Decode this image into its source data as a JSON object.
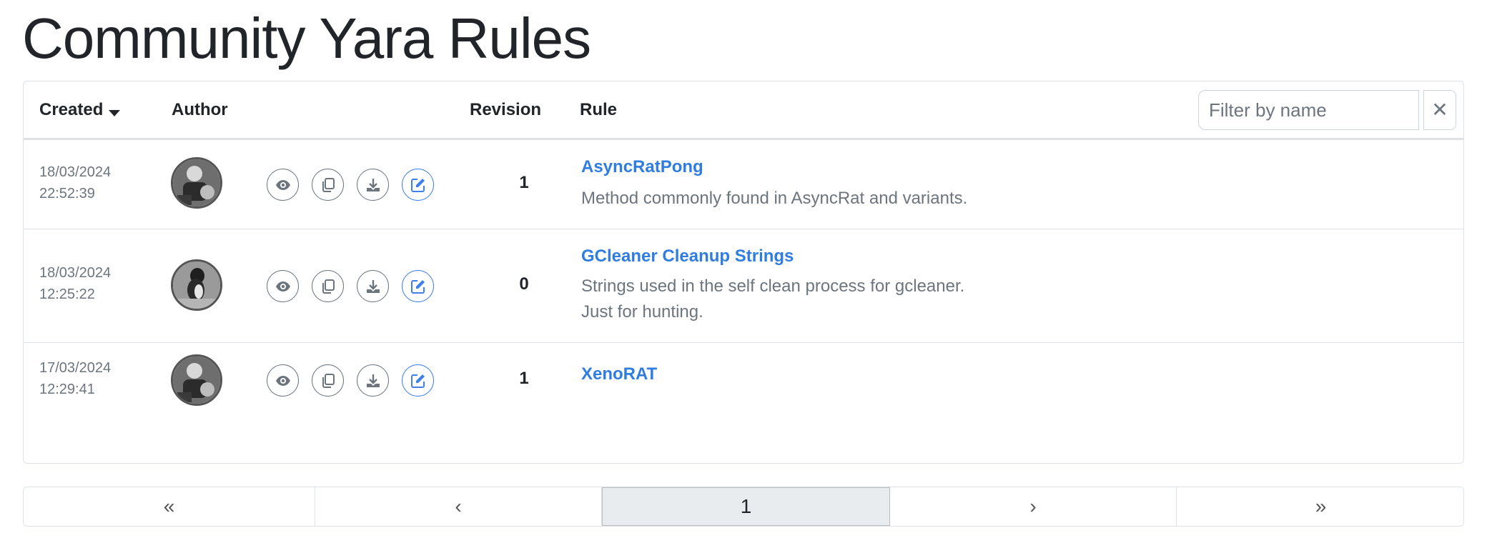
{
  "page": {
    "title": "Community Yara Rules"
  },
  "table": {
    "columns": {
      "created": "Created",
      "author": "Author",
      "revision": "Revision",
      "rule": "Rule"
    },
    "filter": {
      "placeholder": "Filter by name",
      "clear_label": "✕"
    },
    "rows": [
      {
        "date": "18/03/2024",
        "time": "22:52:39",
        "revision": "1",
        "name": "AsyncRatPong",
        "description": [
          "Method commonly found in AsyncRat and variants."
        ]
      },
      {
        "date": "18/03/2024",
        "time": "12:25:22",
        "revision": "0",
        "name": "GCleaner Cleanup Strings",
        "description": [
          "Strings used in the self clean process for gcleaner.",
          "Just for hunting."
        ]
      },
      {
        "date": "17/03/2024",
        "time": "12:29:41",
        "revision": "1",
        "name": "XenoRAT",
        "description": []
      }
    ],
    "action_icons": [
      "eye-icon",
      "copy-icon",
      "download-icon",
      "edit-icon"
    ]
  },
  "pagination": {
    "first": "«",
    "prev": "‹",
    "current": "1",
    "next": "›",
    "last": "»"
  },
  "colors": {
    "link": "#2f7de1",
    "muted": "#6c757d",
    "border": "#dee2e6"
  }
}
